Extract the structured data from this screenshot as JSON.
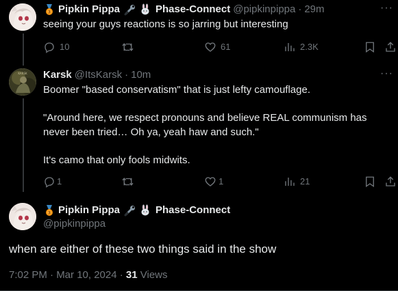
{
  "tweet1": {
    "name": "Pipkin Pippa",
    "org": "Phase-Connect",
    "handle": "@pipkinpippa",
    "sep": "·",
    "time": "29m",
    "text": "seeing your guys reactions is so jarring but interesting",
    "replies": "10",
    "likes": "61",
    "views": "2.3K"
  },
  "tweet2": {
    "name": "Karsk",
    "handle": "@ItsKarsk",
    "sep": "·",
    "time": "10m",
    "text": "Boomer \"based conservatism\" that is just lefty camouflage.\n\n\"Around here, we respect pronouns and believe REAL communism has never been tried… Oh ya, yeah haw and such.\"\n\nIt's camo that only fools midwits.",
    "replies": "1",
    "likes": "1",
    "views": "21"
  },
  "main": {
    "name": "Pipkin Pippa",
    "org": "Phase-Connect",
    "handle": "@pipkinpippa",
    "text": "when are either of these two things said in the show",
    "timestamp": "7:02 PM · Mar 10, 2024 · ",
    "views_count": "31",
    "views_label": " Views"
  },
  "icons": {
    "medal": "medal-emoji-icon",
    "wrench": "wrench-emoji-icon",
    "rabbit": "rabbit-emoji-icon",
    "reply": "reply-icon",
    "retweet": "retweet-icon",
    "like": "heart-icon",
    "views": "views-bar-chart-icon",
    "bookmark": "bookmark-icon",
    "share": "share-icon",
    "more": "more-dots-icon"
  },
  "colors": {
    "background": "#000000",
    "text": "#e7e9ea",
    "secondary": "#71767b",
    "divider": "#2f3336"
  }
}
